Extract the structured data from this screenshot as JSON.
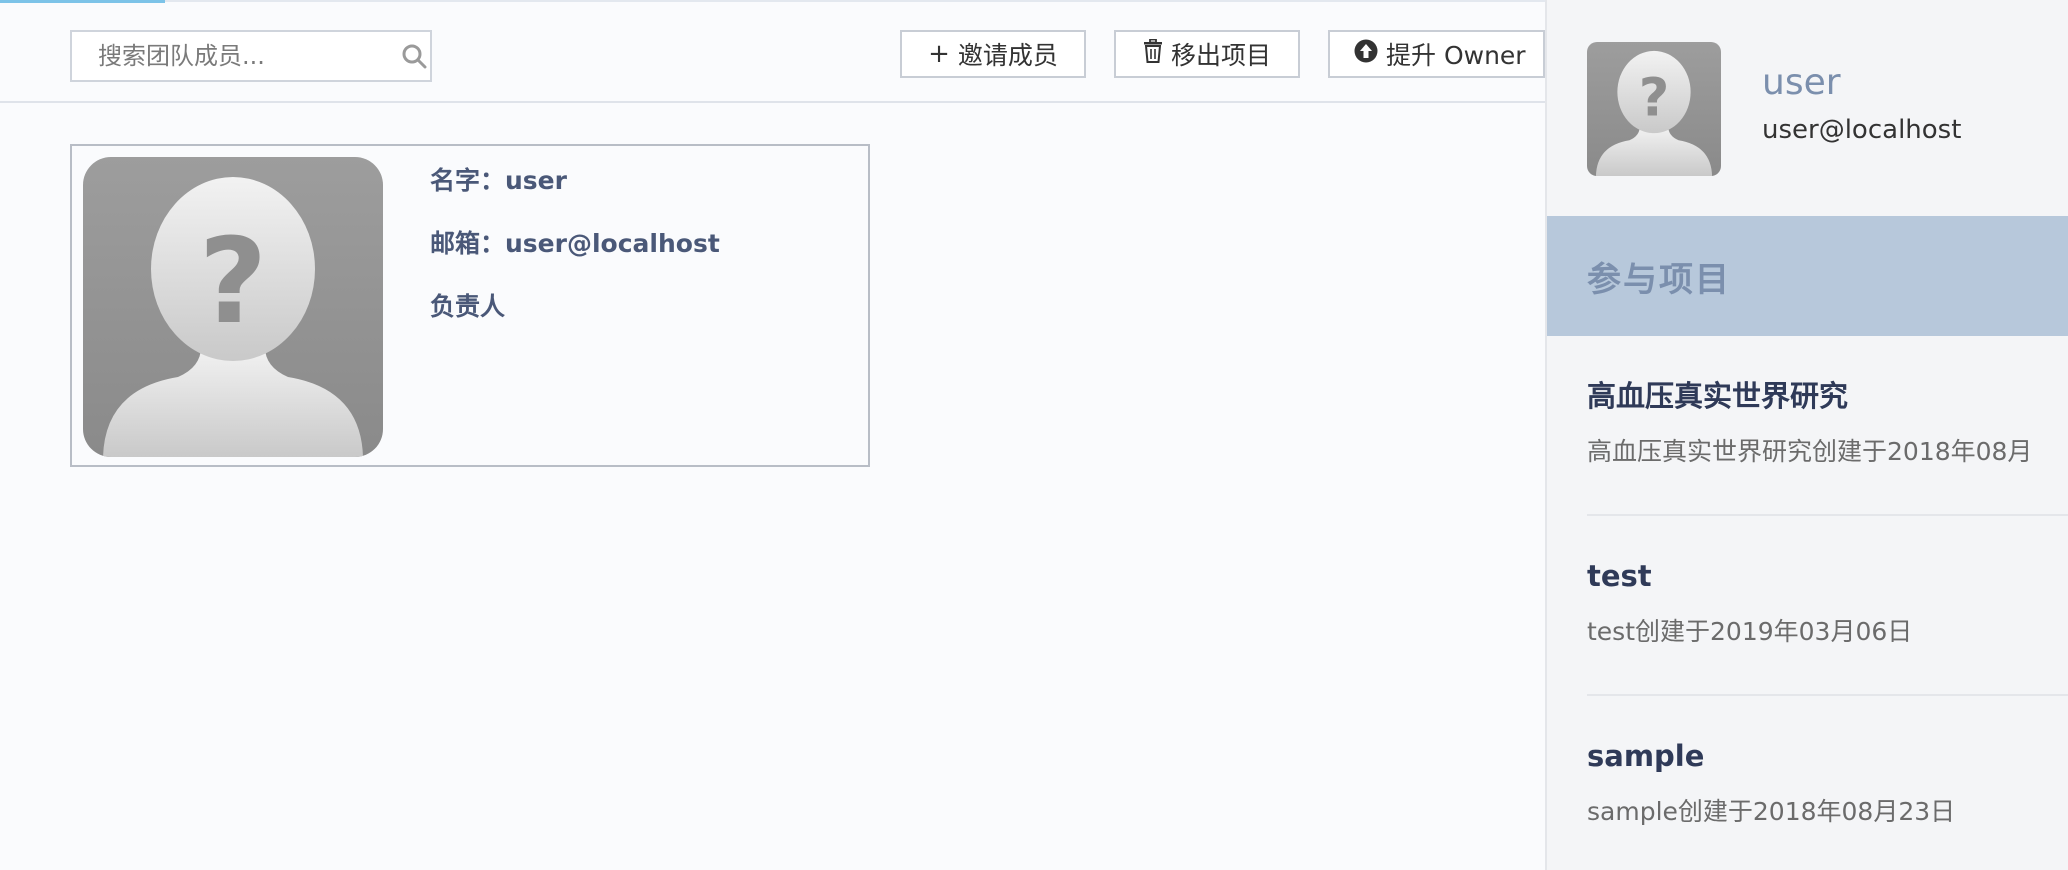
{
  "toolbar": {
    "search_placeholder": "搜索团队成员...",
    "invite_label": "邀请成员",
    "remove_label": "移出项目",
    "promote_label": "提升 Owner"
  },
  "member_card": {
    "name_label": "名字：user",
    "email_label": "邮箱：user@localhost",
    "role_label": "负责人"
  },
  "profile_panel": {
    "name": "user",
    "email": "user@localhost",
    "section_title": "参与项目",
    "projects": [
      {
        "title": "高血压真实世界研究",
        "desc": "高血压真实世界研究创建于2018年08月"
      },
      {
        "title": "test",
        "desc": "test创建于2019年03月06日"
      },
      {
        "title": "sample",
        "desc": "sample创建于2018年08月23日"
      }
    ]
  },
  "colors": {
    "accent": "#7cc3e8",
    "section_bg": "#b7c8db",
    "section_text": "#7b8fad"
  }
}
